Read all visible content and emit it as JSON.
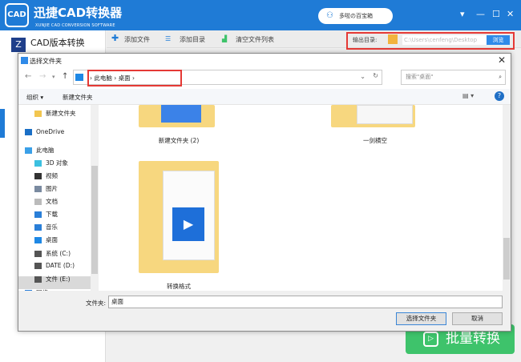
{
  "app": {
    "logo_text": "CAD",
    "title": "迅捷CAD转换器",
    "subtitle": "XUNJIE CAD CONVERSION SOFTWARE",
    "user_name": "多啦の百宝箱",
    "sidebar_item": "CAD版本转换",
    "toolbar": {
      "add_file": "添加文件",
      "add_dir": "添加目录",
      "clear_list": "清空文件列表"
    },
    "output_label": "输出目录:",
    "output_path": "C:\\Users\\cenfeng\\Desktop",
    "browse": "浏览",
    "batch_convert": "批量转换"
  },
  "dialog": {
    "title": "选择文件夹",
    "breadcrumb": [
      "此电脑",
      "桌面"
    ],
    "search_placeholder": "搜索\"桌面\"",
    "organize": "组织 ▾",
    "new_folder": "新建文件夹",
    "nav_items": [
      {
        "label": "新建文件夹",
        "icon": "folder-icon"
      },
      {
        "label": "OneDrive",
        "icon": "cloud-icon"
      },
      {
        "label": "此电脑",
        "icon": "pc-icon"
      },
      {
        "label": "3D 对象",
        "icon": "cube-icon"
      },
      {
        "label": "视频",
        "icon": "video-icon"
      },
      {
        "label": "图片",
        "icon": "picture-icon"
      },
      {
        "label": "文档",
        "icon": "document-icon"
      },
      {
        "label": "下载",
        "icon": "download-icon"
      },
      {
        "label": "音乐",
        "icon": "music-icon"
      },
      {
        "label": "桌面",
        "icon": "desktop-icon"
      },
      {
        "label": "系统 (C:)",
        "icon": "drive-icon"
      },
      {
        "label": "DATE (D:)",
        "icon": "drive-icon"
      },
      {
        "label": "文件 (E:)",
        "icon": "drive-icon"
      },
      {
        "label": "网络",
        "icon": "network-icon"
      }
    ],
    "folders": [
      "新建文件夹 (2)",
      "一剑横空",
      "转换格式"
    ],
    "filename_label": "文件夹:",
    "filename_value": "桌面",
    "select_button": "选择文件夹",
    "cancel_button": "取消"
  }
}
